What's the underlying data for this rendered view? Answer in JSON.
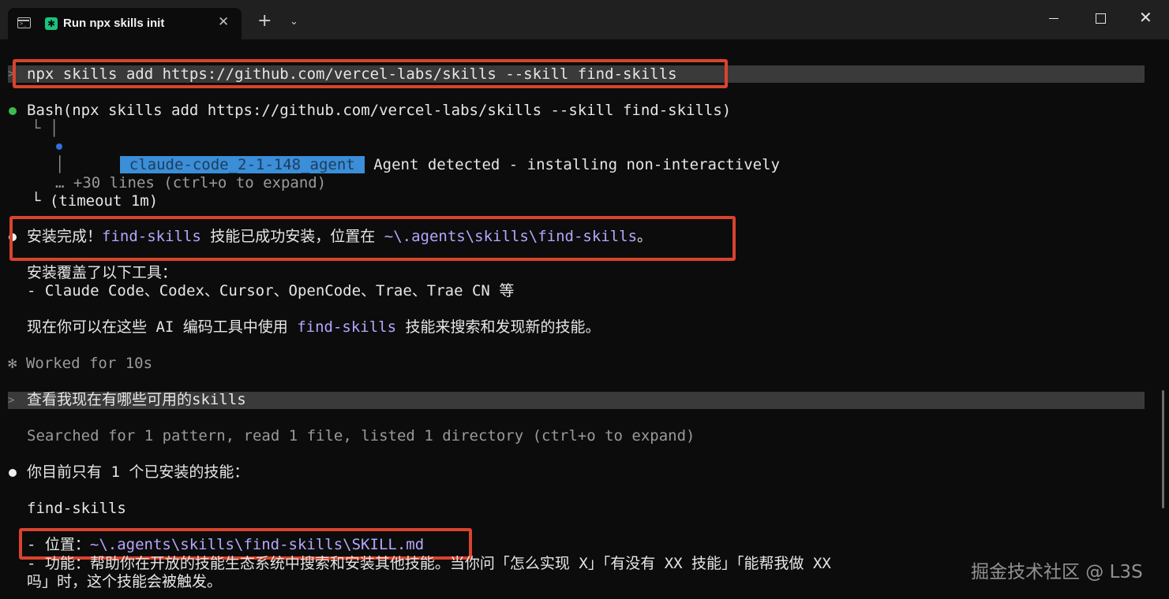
{
  "window": {
    "tab_title": "Run npx skills init",
    "tab_close": "✕",
    "new_tab": "+",
    "dropdown": "⌄",
    "close": "✕"
  },
  "terminal": {
    "command1": "npx skills add https://github.com/vercel-labs/skills --skill find-skills",
    "bash_call": "Bash(npx skills add https://github.com/vercel-labs/skills --skill find-skills)",
    "tree_pipe1": "└ │",
    "agent_badge": "claude-code_2-1-148_agent",
    "agent_message": "Agent detected - installing non-interactively",
    "tree_pipe2": "│",
    "collapsed_lines": "… +30 lines (ctrl+o to expand)",
    "timeout": "└ (timeout 1m)",
    "install_done_prefix": "安装完成！",
    "install_done_skill": "find-skills",
    "install_done_mid": " 技能已成功安装，位置在 ",
    "install_done_path": "~\\.agents\\skills\\find-skills",
    "install_done_suffix": "。",
    "tools_heading": "安装覆盖了以下工具：",
    "tools_list": "- Claude Code、Codex、Cursor、OpenCode、Trae、Trae CN 等",
    "usage_prefix": "现在你可以在这些 AI 编码工具中使用 ",
    "usage_skill": "find-skills",
    "usage_suffix": " 技能来搜索和发现新的技能。",
    "worked": "✻ Worked for 10s",
    "prompt2": "查看我现在有哪些可用的skills",
    "searched": "Searched for 1 pattern, read 1 file, listed 1 directory (ctrl+o to expand)",
    "answer": "你目前只有 1 个已安装的技能：",
    "skill_name": "find-skills",
    "location_prefix": "- 位置：",
    "location_path": "~\\.agents\\skills\\find-skills\\SKILL.md",
    "function_line": "- 功能：帮助你在开放的技能生态系统中搜索和安装其他技能。当你问「怎么实现 X」「有没有 XX 技能」「能帮我做 XX",
    "function_line2": "吗」时，这个技能会被触发。",
    "prompt_marker": ">"
  },
  "watermark": "掘金技术社区 @ L3S",
  "colors": {
    "success_dot": "#3fb950",
    "highlight_box": "#d9432e",
    "skill_text": "#b4a7ff",
    "selection": "#3b8ed8"
  }
}
